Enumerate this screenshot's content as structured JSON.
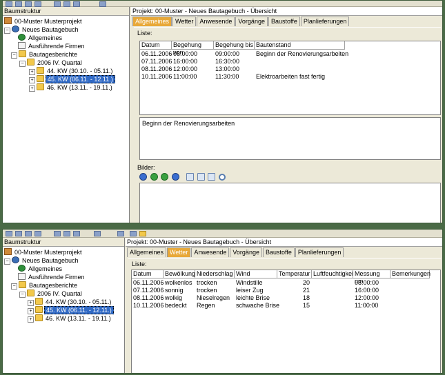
{
  "tree": {
    "title": "Baumstruktur",
    "root": "00-Muster Musterprojekt",
    "project": "Neues Bautagebuch",
    "allgemeines": "Allgemeines",
    "firmen": "Ausführende Firmen",
    "berichte": "Bautagesberichte",
    "quarter": "2006 IV. Quartal",
    "kw44": "44. KW (30.10. - 05.11.)",
    "kw45": "45. KW (06.11. - 12.11.)",
    "kw46": "46. KW (13.11. - 19.11.)"
  },
  "project_title": "Projekt: 00-Muster - Neues Bautagebuch - Übersicht",
  "tabs": [
    "Allgemeines",
    "Wetter",
    "Anwesende",
    "Vorgänge",
    "Baustoffe",
    "Planlieferungen"
  ],
  "liste_label": "Liste:",
  "bilder_label": "Bilder:",
  "allgemeines": {
    "headers": [
      "Datum",
      "Begehung von",
      "Begehung bis",
      "Bautenstand"
    ],
    "rows": [
      [
        "06.11.2006",
        "08:00:00",
        "09:00:00",
        "Beginn der Renovierungsarbeiten"
      ],
      [
        "07.11.2006",
        "16:00:00",
        "16:30:00",
        ""
      ],
      [
        "08.11.2006",
        "12:00:00",
        "13:00:00",
        ""
      ],
      [
        "10.11.2006",
        "11:00:00",
        "11:30:00",
        "Elektroarbeiten fast fertig"
      ]
    ],
    "memo": "Beginn der Renovierungsarbeiten"
  },
  "wetter": {
    "headers": [
      "Datum",
      "Bewölkung",
      "Niederschlag",
      "Wind",
      "Temperatur",
      "Luftfeuchtigkeit",
      "Messung um",
      "Bemerkungen"
    ],
    "rows": [
      [
        "06.11.2006",
        "wolkenlos",
        "trocken",
        "Windstille",
        "20",
        "",
        "08:00:00",
        ""
      ],
      [
        "07.11.2006",
        "sonnig",
        "trocken",
        "leiser Zug",
        "21",
        "",
        "16:00:00",
        ""
      ],
      [
        "08.11.2006",
        "wolkig",
        "Nieselregen",
        "leichte Brise",
        "18",
        "",
        "12:00:00",
        ""
      ],
      [
        "10.11.2006",
        "bedeckt",
        "Regen",
        "schwache Brise",
        "15",
        "",
        "11:00:00",
        ""
      ]
    ]
  },
  "colors": {
    "active_tab": "#e8a838",
    "selection": "#316ac5",
    "frame": "#4a6a46"
  }
}
